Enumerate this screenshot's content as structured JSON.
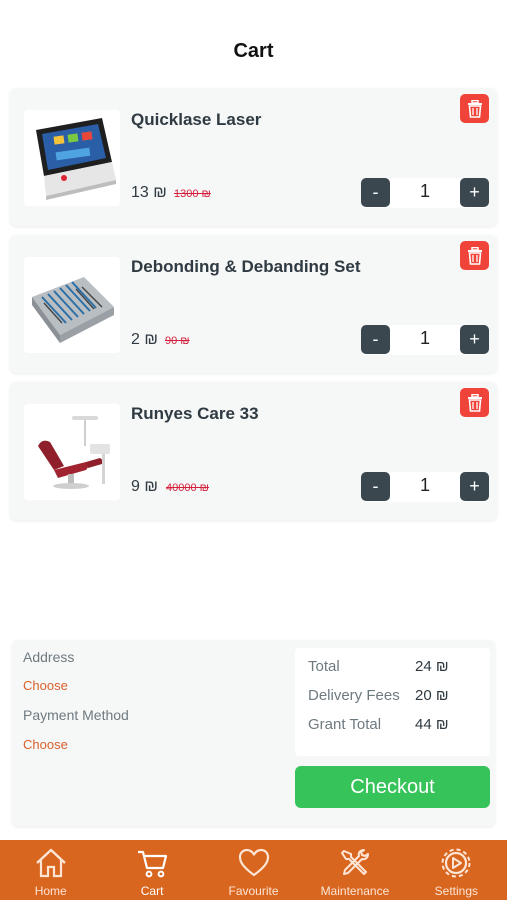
{
  "header": {
    "title": "Cart"
  },
  "items": [
    {
      "name": "Quicklase Laser",
      "price": "13 ₪",
      "old_price": "1300 ₪",
      "qty": "1",
      "thumb_icon": "laser-device-image"
    },
    {
      "name": "Debonding & Debanding Set",
      "price": "2 ₪",
      "old_price": "90 ₪",
      "qty": "1",
      "thumb_icon": "instrument-set-image"
    },
    {
      "name": "Runyes Care 33",
      "price": "9 ₪",
      "old_price": "40000 ₪",
      "qty": "1",
      "thumb_icon": "dental-chair-image"
    }
  ],
  "stepper": {
    "minus": "-",
    "plus": "+"
  },
  "summary": {
    "address_label": "Address",
    "address_choose": "Choose",
    "payment_label": "Payment Method",
    "payment_choose": "Choose",
    "total_label": "Total",
    "total_value": "24 ₪",
    "delivery_label": "Delivery Fees",
    "delivery_value": "20 ₪",
    "grant_label": "Grant Total",
    "grant_value": "44 ₪",
    "checkout_label": "Checkout"
  },
  "tabbar": [
    {
      "label": "Home",
      "icon": "home-icon"
    },
    {
      "label": "Cart",
      "icon": "cart-icon",
      "active": true
    },
    {
      "label": "Favourite",
      "icon": "heart-icon"
    },
    {
      "label": "Maintenance",
      "icon": "tools-icon"
    },
    {
      "label": "Settings",
      "icon": "gear-icon"
    }
  ],
  "colors": {
    "accent": "#d9661f",
    "checkout": "#36c45a",
    "delete": "#f0443a",
    "stepper": "#3a474f",
    "strike": "#d4203c"
  }
}
